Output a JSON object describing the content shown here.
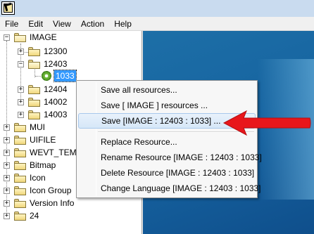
{
  "menubar": {
    "items": [
      "File",
      "Edit",
      "View",
      "Action",
      "Help"
    ]
  },
  "tree": {
    "image": "IMAGE",
    "image_children": [
      "12300",
      "12403",
      "12404",
      "14002",
      "14003"
    ],
    "selected_resource": "1033",
    "roots": [
      "MUI",
      "UIFILE",
      "WEVT_TEM",
      "Bitmap",
      "Icon",
      "Icon Group",
      "Version Info",
      "24"
    ]
  },
  "context_menu": {
    "items": [
      "Save all resources...",
      "Save [ IMAGE ] resources ...",
      "Save [IMAGE : 12403 : 1033] ...",
      "Replace Resource...",
      "Rename Resource [IMAGE : 12403 : 1033]",
      "Delete Resource [IMAGE : 12403 : 1033]",
      "Change Language [IMAGE : 12403 : 1033]"
    ],
    "highlighted_index": 2
  },
  "colors": {
    "selection": "#3399ff",
    "annotation_arrow": "#e8161b",
    "desktop": "#1663a0"
  }
}
